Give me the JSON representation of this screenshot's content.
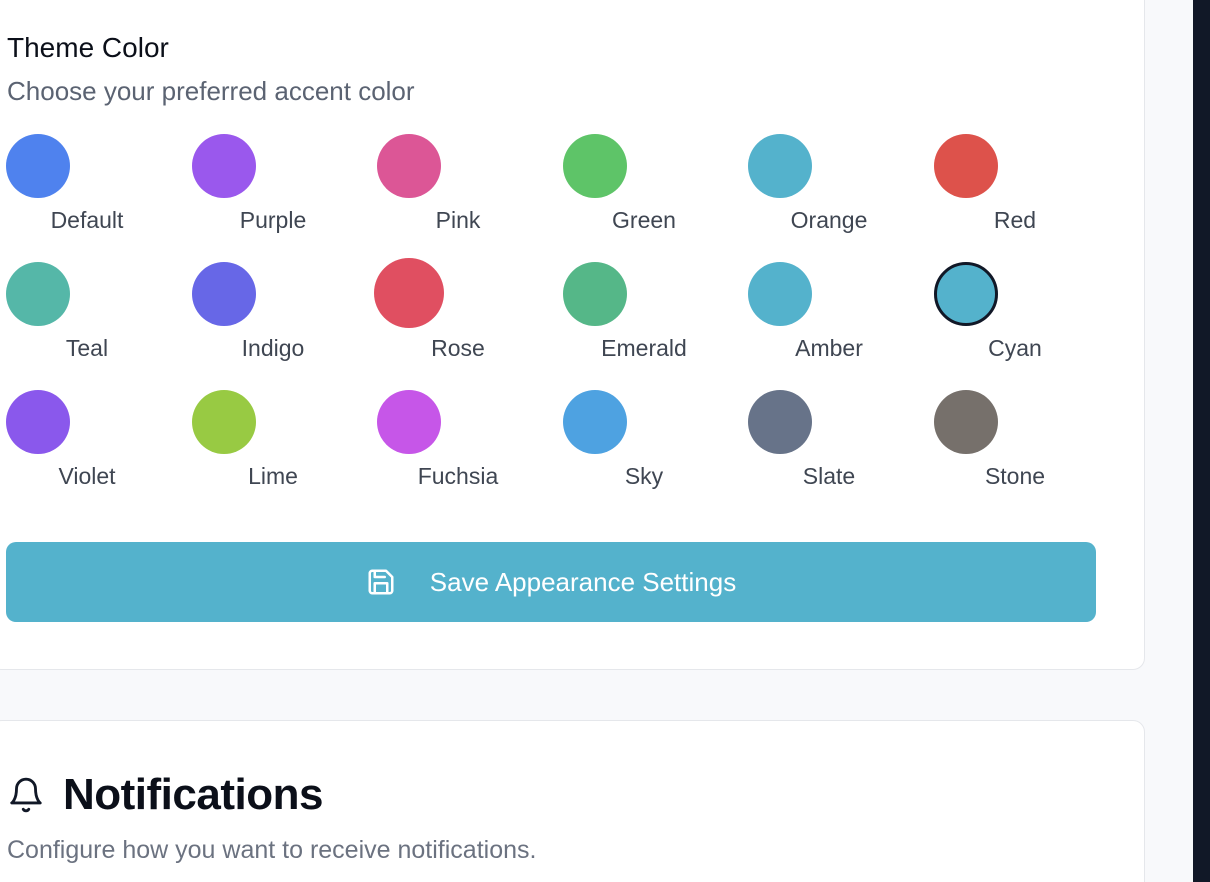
{
  "colors": {
    "accent": "#54b2cc",
    "selected_ring": "#111827"
  },
  "theme": {
    "title": "Theme Color",
    "subtitle": "Choose your preferred accent color",
    "swatches": [
      [
        {
          "label": "Default",
          "color": "#4f82ee"
        },
        {
          "label": "Purple",
          "color": "#9a58ed"
        },
        {
          "label": "Pink",
          "color": "#dc5696"
        },
        {
          "label": "Green",
          "color": "#5ec468"
        },
        {
          "label": "Orange",
          "color": "#54b2cc"
        },
        {
          "label": "Red",
          "color": "#dd524b"
        }
      ],
      [
        {
          "label": "Teal",
          "color": "#55b7a8"
        },
        {
          "label": "Indigo",
          "color": "#6767e7"
        },
        {
          "label": "Rose",
          "color": "#e04f61"
        },
        {
          "label": "Emerald",
          "color": "#55b788"
        },
        {
          "label": "Amber",
          "color": "#54b2cc"
        },
        {
          "label": "Cyan",
          "color": "#54b2cc",
          "selected": true
        }
      ],
      [
        {
          "label": "Violet",
          "color": "#8a58ec"
        },
        {
          "label": "Lime",
          "color": "#98ca43"
        },
        {
          "label": "Fuchsia",
          "color": "#c656e8"
        },
        {
          "label": "Sky",
          "color": "#4ea2e1"
        },
        {
          "label": "Slate",
          "color": "#677389"
        },
        {
          "label": "Stone",
          "color": "#76706b"
        }
      ]
    ],
    "save_label": "Save Appearance Settings",
    "save_icon": "save-icon"
  },
  "notifications": {
    "icon": "bell-icon",
    "title": "Notifications",
    "subtitle": "Configure how you want to receive notifications."
  }
}
